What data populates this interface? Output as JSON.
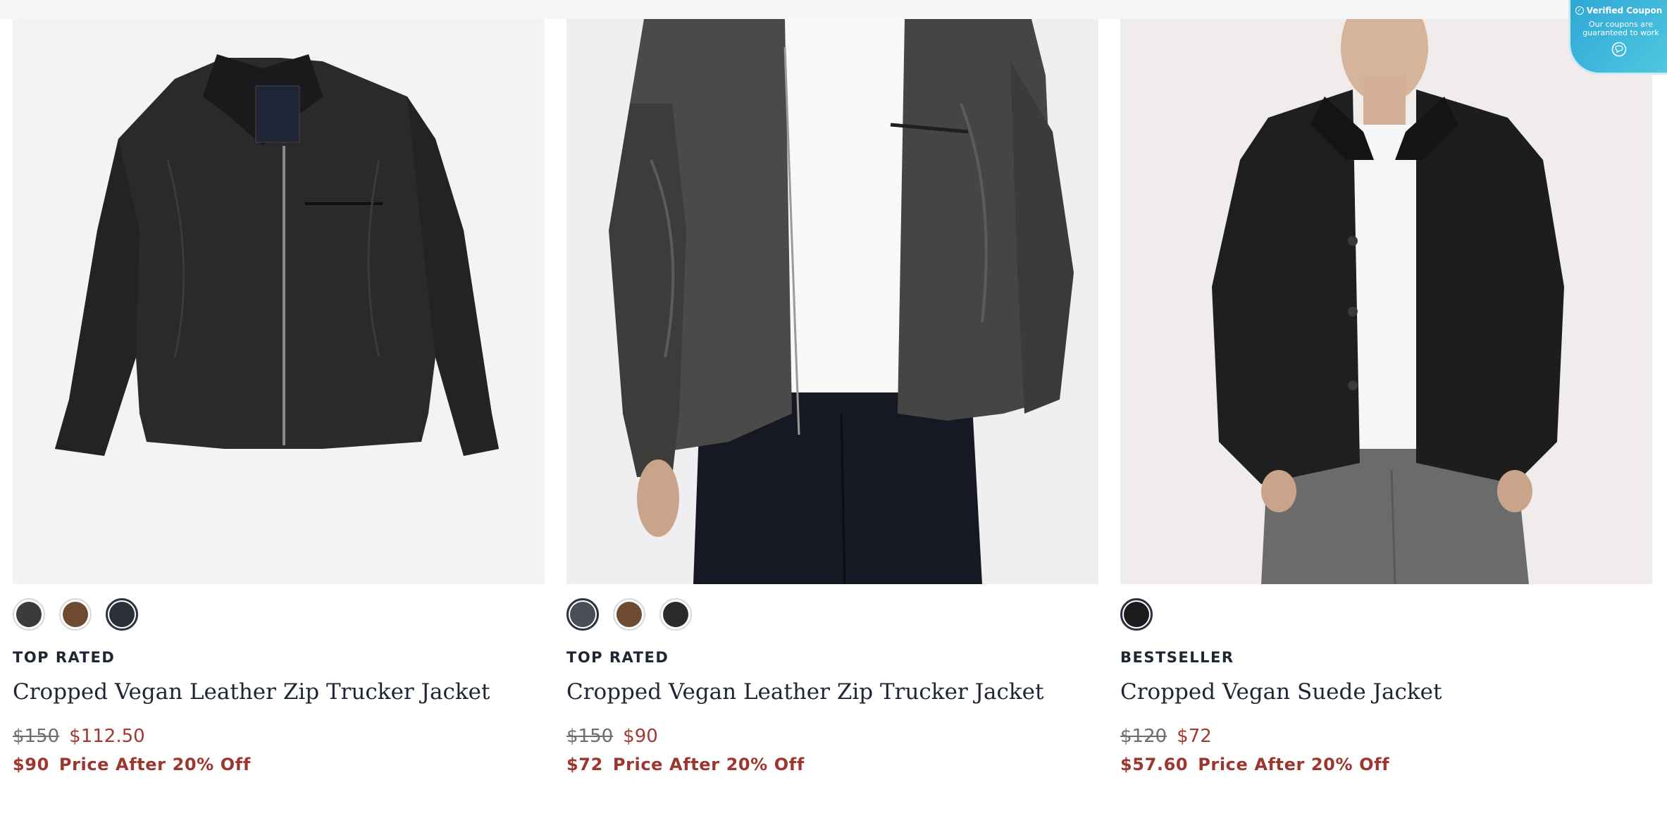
{
  "products": [
    {
      "badge": "TOP RATED",
      "title": "Cropped Vegan Leather Zip Trucker Jacket",
      "price_original": "$150",
      "price_sale": "$112.50",
      "promo_price": "$90",
      "promo_label": "Price After 20% Off",
      "image": "black vegan leather zip jacket, flat lay",
      "swatches": [
        {
          "name": "black",
          "color": "#3b3b3b",
          "selected": false
        },
        {
          "name": "brown",
          "color": "#6e4a32",
          "selected": false
        },
        {
          "name": "washed black",
          "color": "#2b2f38",
          "selected": true
        }
      ]
    },
    {
      "badge": "TOP RATED",
      "title": "Cropped Vegan Leather Zip Trucker Jacket",
      "price_original": "$150",
      "price_sale": "$90",
      "promo_price": "$72",
      "promo_label": "Price After 20% Off",
      "image": "model wearing washed grey leather zip jacket over white tee",
      "swatches": [
        {
          "name": "washed grey",
          "color": "#4a4f55",
          "selected": true
        },
        {
          "name": "brown",
          "color": "#6e4a32",
          "selected": false
        },
        {
          "name": "black",
          "color": "#2a2a2a",
          "selected": false
        }
      ]
    },
    {
      "badge": "BESTSELLER",
      "title": "Cropped Vegan Suede Jacket",
      "price_original": "$120",
      "price_sale": "$72",
      "promo_price": "$57.60",
      "promo_label": "Price After 20% Off",
      "image": "model wearing black vegan suede jacket with grey trousers",
      "swatches": [
        {
          "name": "black",
          "color": "#1c1c1e",
          "selected": true
        }
      ]
    }
  ],
  "coupon_widget": {
    "title": "Verified Coupon",
    "message": "Our coupons are guaranteed to work",
    "icon": "chat-icon"
  },
  "colors": {
    "sale_red": "#a13a32",
    "text_dark": "#1f2633",
    "coupon_blue": "#2fa7d6"
  }
}
